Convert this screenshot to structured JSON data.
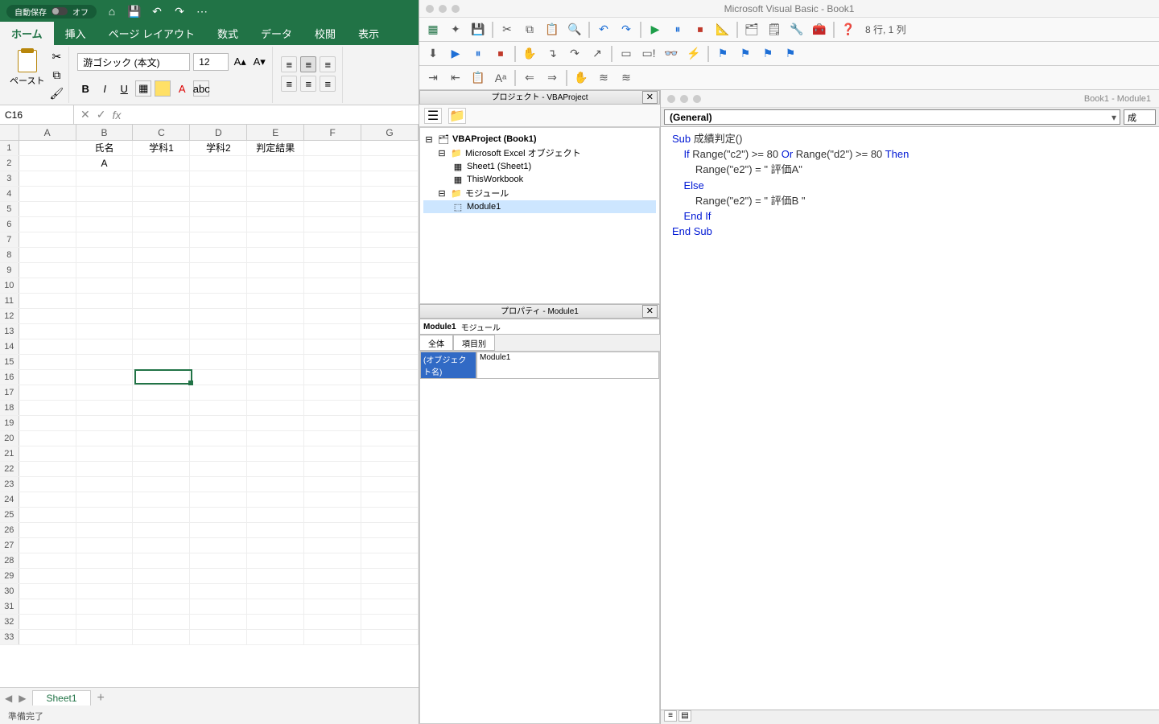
{
  "excel": {
    "autosave_label": "自動保存",
    "autosave_off": "オフ",
    "tabs": [
      "ホーム",
      "挿入",
      "ページ レイアウト",
      "数式",
      "データ",
      "校閲",
      "表示"
    ],
    "paste_label": "ペースト",
    "font_name": "游ゴシック (本文)",
    "font_size": "12",
    "namebox": "C16",
    "columns": [
      "A",
      "B",
      "C",
      "D",
      "E",
      "F",
      "G"
    ],
    "row_count": 33,
    "data": {
      "1": {
        "B": "氏名",
        "C": "学科1",
        "D": "学科2",
        "E": "判定結果"
      },
      "2": {
        "B": "A"
      }
    },
    "selected": {
      "row": 16,
      "col": "C"
    },
    "sheet_tab": "Sheet1",
    "status": "準備完了"
  },
  "vbe": {
    "title": "Microsoft Visual Basic - Book1",
    "cursor_status": "8 行, 1 列",
    "project_pane_title": "プロジェクト - VBAProject",
    "props_pane_title": "プロパティ - Module1",
    "code_window_title": "Book1 - Module1",
    "proc_dropdown": "(General)",
    "proc_right": "成",
    "tree": {
      "root": "VBAProject (Book1)",
      "folder1": "Microsoft Excel オブジェクト",
      "sheet1": "Sheet1 (Sheet1)",
      "thiswb": "ThisWorkbook",
      "folder2": "モジュール",
      "module1": "Module1"
    },
    "props": {
      "selector_name": "Module1",
      "selector_type": "モジュール",
      "tab_all": "全体",
      "tab_cat": "項目別",
      "row_key": "(オブジェクト名)",
      "row_val": "Module1"
    },
    "code": {
      "l1a": "Sub",
      "l1b": " 成績判定()",
      "l2a": "    If",
      "l2b": " Range(\"c2\") >= 80 ",
      "l2c": "Or",
      "l2d": " Range(\"d2\") >= 80 ",
      "l2e": "Then",
      "l3": "        Range(\"e2\") = \" 評価A\"",
      "l4": "    Else",
      "l5": "        Range(\"e2\") = \" 評価B \"",
      "l6": "    End If",
      "l7": "End Sub"
    }
  }
}
